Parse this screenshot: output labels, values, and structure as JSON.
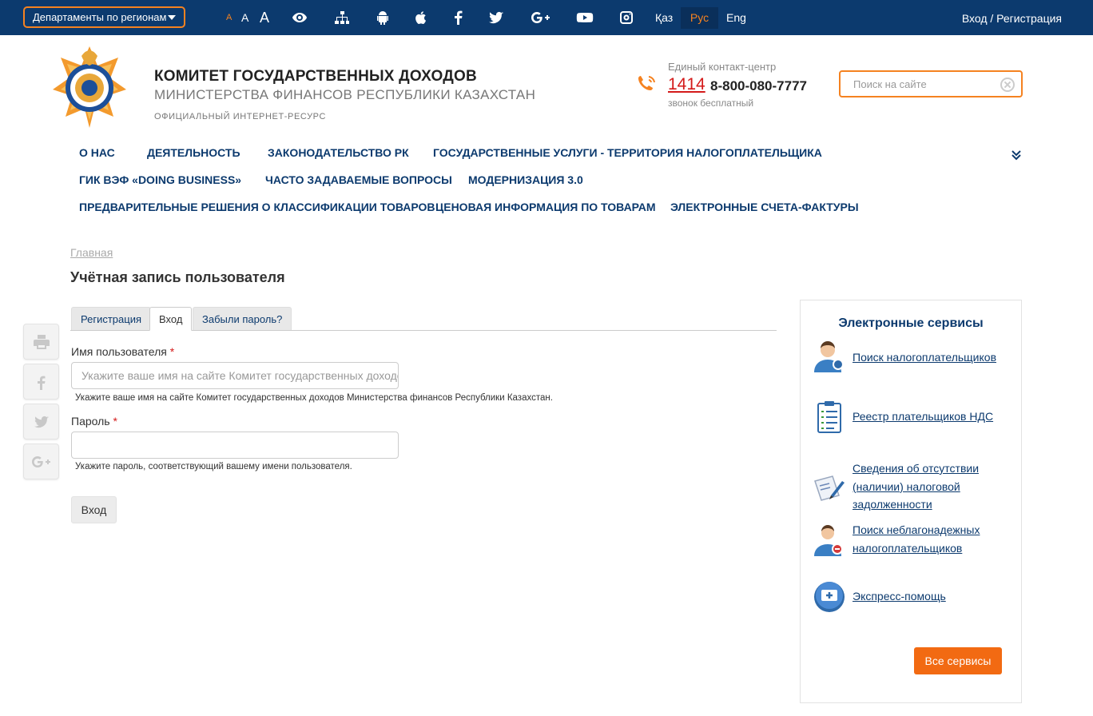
{
  "topbar": {
    "dept_label": "Департаменты по регионам",
    "font_sizes": [
      "A",
      "A",
      "A"
    ],
    "icons": [
      "eye-icon",
      "sitemap-icon",
      "android-icon",
      "apple-icon",
      "facebook-icon",
      "twitter-icon",
      "google-plus-icon",
      "youtube-icon",
      "instagram-icon"
    ],
    "languages": [
      {
        "label": "Қаз",
        "active": false
      },
      {
        "label": "Рус",
        "active": true
      },
      {
        "label": "Eng",
        "active": false
      }
    ],
    "login": "Вход / Регистрация"
  },
  "header": {
    "title": "КОМИТЕТ ГОСУДАРСТВЕННЫХ ДОХОДОВ",
    "subtitle": "МИНИСТЕРСТВА ФИНАНСОВ РЕСПУБЛИКИ КАЗАХСТАН",
    "official": "ОФИЦИАЛЬНЫЙ ИНТЕРНЕТ-РЕСУРС",
    "contact_label": "Единый контакт-центр",
    "contact_short": "1414",
    "contact_long": "8-800-080-7777",
    "contact_free": "звонок бесплатный",
    "search_placeholder": "Поиск на сайте"
  },
  "nav": {
    "items": [
      "О нас",
      "Деятельность",
      "Законодательство РК",
      "Государственные услуги - территория налогоплательщика",
      "ГИК ВЭФ «Doing Business»",
      "Часто задаваемые вопросы",
      "Модернизация 3.0",
      "Предварительные решения о классификации товаров",
      "Ценовая информация по товарам",
      "Электронные счета-фактуры"
    ]
  },
  "content": {
    "breadcrumb": "Главная",
    "title": "Учётная запись пользователя",
    "tabs": [
      {
        "label": "Регистрация",
        "active": false
      },
      {
        "label": "Вход",
        "active": true
      },
      {
        "label": "Забыли пароль?",
        "active": false
      }
    ],
    "username": {
      "label": "Имя пользователя",
      "required_mark": "*",
      "placeholder": "Укажите ваше имя на сайте Комитет государственных доходов Министерства финансов Республики Казахстан.",
      "description": "Укажите ваше имя на сайте Комитет государственных доходов Министерства финансов Республики Казахстан."
    },
    "password": {
      "label": "Пароль",
      "required_mark": "*",
      "description": "Укажите пароль, соответствующий вашему имени пользователя."
    },
    "submit": "Вход"
  },
  "share": [
    "print-icon",
    "facebook-icon",
    "twitter-icon",
    "google-plus-icon"
  ],
  "services": {
    "title": "Электронные сервисы",
    "items": [
      "Поиск налогоплательщиков",
      "Реестр плательщиков НДС",
      "Сведения об отсутствии (наличии) налоговой задолженности",
      "Поиск неблагонадежных налогоплательщиков",
      "Экспресс-помощь"
    ],
    "all_button": "Все сервисы"
  },
  "colors": {
    "brand_blue": "#0c3a6e",
    "accent_orange": "#f58220",
    "button_orange": "#f26a12",
    "required_red": "#d41a1a"
  }
}
